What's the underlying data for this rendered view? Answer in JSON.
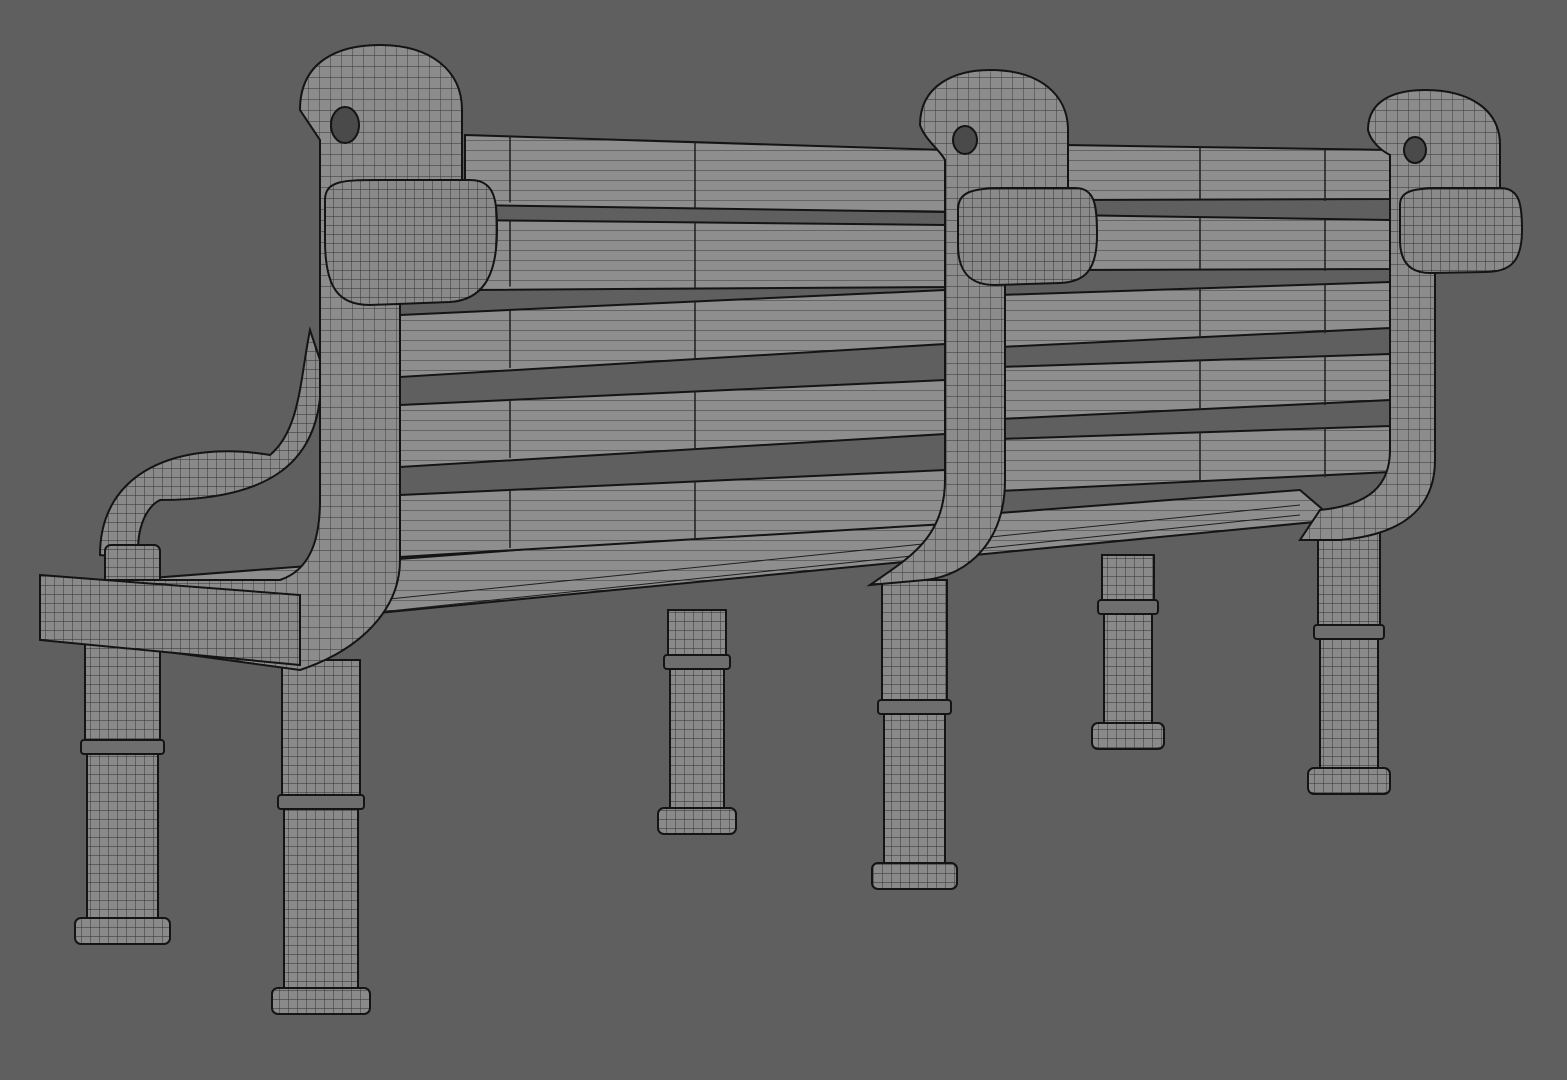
{
  "scene": {
    "background_color": "#5f5f5f",
    "mesh_fill": "#8c8c8c",
    "mesh_fill_light": "#989898",
    "mesh_fill_dark": "#6e6e6e",
    "wire_color": "#1e1e1e",
    "outline_color": "#141414"
  },
  "model": {
    "subject": "bench-wireframe",
    "slat_count_back": 5,
    "leg_count": 6
  }
}
